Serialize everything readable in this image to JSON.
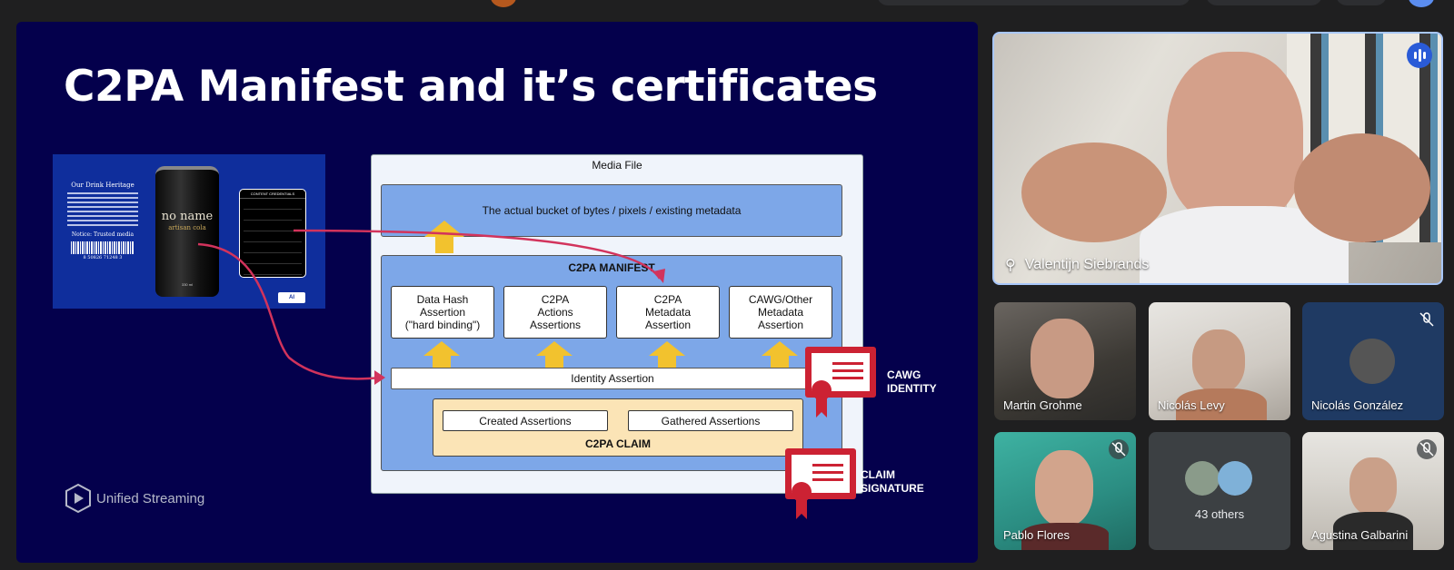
{
  "slide": {
    "title": "C2PA Manifest and it’s certificates",
    "product_image": {
      "heritage_title": "Our Drink Heritage",
      "heritage_notice": "Notice: Trusted media",
      "barcode_number": "8 50826 71248 3",
      "can_name": "no name",
      "can_subtitle": "artisan cola",
      "can_volume": "330 ml",
      "credentials_title": "CONTENT CREDENTIALS",
      "ai_badge": "AI"
    },
    "diagram": {
      "media_file_label": "Media File",
      "bytes_label": "The actual bucket of bytes / pixels / existing metadata",
      "manifest_label": "C2PA MANIFEST",
      "assertions": [
        {
          "label": "Data Hash\nAssertion\n(\"hard binding\")"
        },
        {
          "label": "C2PA\nActions\nAssertions"
        },
        {
          "label": "C2PA\nMetadata\nAssertion"
        },
        {
          "label": "CAWG/Other\nMetadata\nAssertion"
        }
      ],
      "identity_label": "Identity Assertion",
      "claim_items": [
        "Created Assertions",
        "Gathered Assertions"
      ],
      "claim_label": "C2PA CLAIM"
    },
    "certificates": [
      {
        "line1": "CAWG",
        "line2": "IDENTITY"
      },
      {
        "line1": "CLAIM",
        "line2": "SIGNATURE"
      }
    ],
    "logo_text": "Unified Streaming",
    "colors": {
      "background": "#04004c",
      "accent_red": "#cc2233",
      "arrow_yellow": "#f2c22e",
      "box_blue": "#7da7e8"
    }
  },
  "participants": {
    "main": {
      "name": "Valentijn Siebrands",
      "speaking": true,
      "pinned": true
    },
    "tiles": [
      {
        "name": "Martin Grohme",
        "muted": false
      },
      {
        "name": "Nicolás Levy",
        "muted": false
      },
      {
        "name": "Nicolás González",
        "muted": true
      },
      {
        "name": "Pablo Flores",
        "muted": true
      },
      {
        "others_label": "43 others"
      },
      {
        "name": "Agustina Galbarini",
        "muted": true
      }
    ]
  }
}
